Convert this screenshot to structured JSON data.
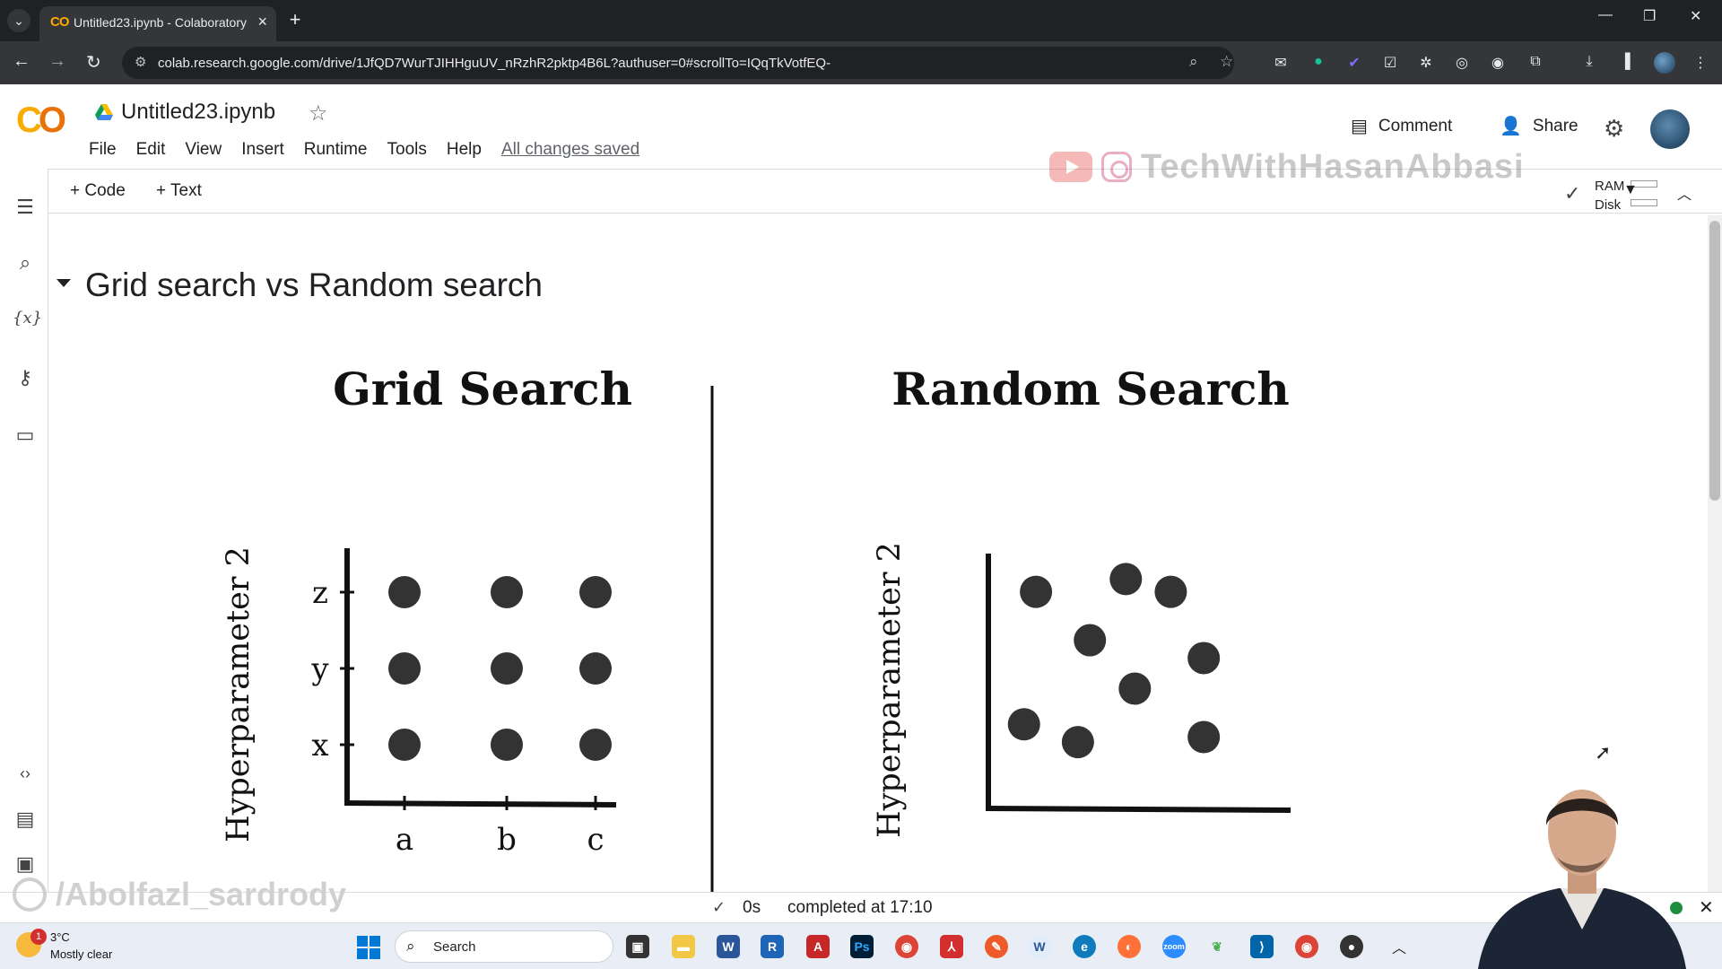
{
  "browser": {
    "tab_title": "Untitled23.ipynb - Colaboratory",
    "tab_favicon": "CO",
    "url": "colab.research.google.com/drive/1JfQD7WurTJIHHguUV_nRzhR2pktp4B6L?authuser=0#scrollTo=IQqTkVotfEQ-"
  },
  "colab": {
    "logo": "CO",
    "notebook_title": "Untitled23.ipynb",
    "menu": [
      "File",
      "Edit",
      "View",
      "Insert",
      "Runtime",
      "Tools",
      "Help"
    ],
    "save_status": "All changes saved",
    "comment_label": "Comment",
    "share_label": "Share",
    "toolbar": {
      "add_code": "+ Code",
      "add_text": "+ Text",
      "ram_label": "RAM",
      "disk_label": "Disk"
    }
  },
  "watermark": {
    "channel": "TechWithHasanAbbasi",
    "handle": "/Abolfazl_sardrody"
  },
  "section": {
    "title": "Grid search vs Random search"
  },
  "figure": {
    "grid_title": "Grid Search",
    "random_title": "Random Search",
    "grid_ylabel": "Hyperparameter 2",
    "random_ylabel": "Hyperparameter 2",
    "grid_yticks": [
      "x",
      "y",
      "z"
    ],
    "grid_xticks": [
      "a",
      "b",
      "c"
    ]
  },
  "chart_data": [
    {
      "type": "scatter",
      "title": "Grid Search",
      "ylabel": "Hyperparameter 2",
      "x_categories": [
        "a",
        "b",
        "c"
      ],
      "y_categories": [
        "x",
        "y",
        "z"
      ],
      "points": [
        {
          "x": "a",
          "y": "z"
        },
        {
          "x": "b",
          "y": "z"
        },
        {
          "x": "c",
          "y": "z"
        },
        {
          "x": "a",
          "y": "y"
        },
        {
          "x": "b",
          "y": "y"
        },
        {
          "x": "c",
          "y": "y"
        },
        {
          "x": "a",
          "y": "x"
        },
        {
          "x": "b",
          "y": "x"
        },
        {
          "x": "c",
          "y": "x"
        }
      ]
    },
    {
      "type": "scatter",
      "title": "Random Search",
      "ylabel": "Hyperparameter 2",
      "xlim": [
        0,
        10
      ],
      "ylim": [
        0,
        10
      ],
      "points": [
        {
          "x": 1.5,
          "y": 8.5
        },
        {
          "x": 4.5,
          "y": 9.0
        },
        {
          "x": 6.0,
          "y": 8.5
        },
        {
          "x": 3.3,
          "y": 6.6
        },
        {
          "x": 7.1,
          "y": 5.9
        },
        {
          "x": 4.8,
          "y": 4.7
        },
        {
          "x": 1.1,
          "y": 3.3
        },
        {
          "x": 2.9,
          "y": 2.6
        },
        {
          "x": 7.1,
          "y": 2.8
        }
      ]
    }
  ],
  "status": {
    "elapsed": "0s",
    "completed": "completed at 17:10"
  },
  "taskbar": {
    "temperature": "3°C",
    "condition": "Mostly clear",
    "weather_badge": "1",
    "search_label": "Search"
  },
  "colors": {
    "colab_orange": "#f9ab00",
    "chrome_dark": "#202124",
    "marker": "#333333",
    "running_green": "#1e8e3e"
  }
}
